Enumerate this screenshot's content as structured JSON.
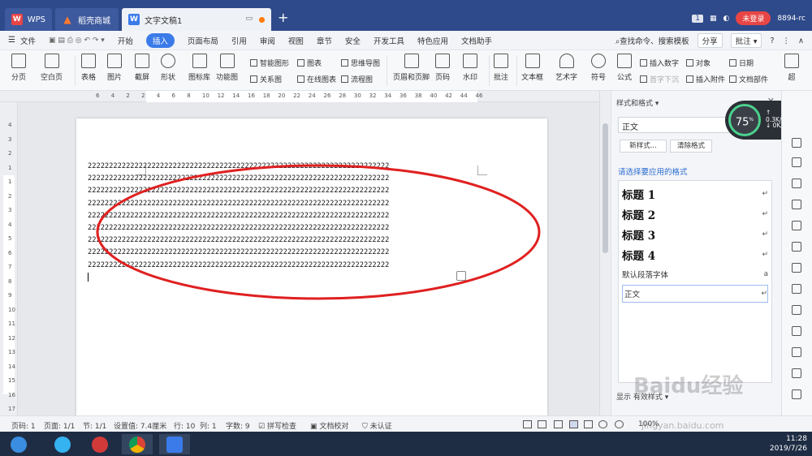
{
  "tabs": {
    "wps": "WPS",
    "mall": "稻壳商城",
    "doc": "文字文稿1",
    "badge_count": "1",
    "login": "未登录",
    "user": "8894-rc"
  },
  "menu": {
    "file": "文件",
    "items": [
      "开始",
      "插入",
      "页面布局",
      "引用",
      "审阅",
      "视图",
      "章节",
      "安全",
      "开发工具",
      "特色应用",
      "文档助手"
    ],
    "active_index": 1,
    "search": "查找命令、搜索模板",
    "share": "分享",
    "comment": "批注"
  },
  "ribbon": {
    "big": [
      "分页",
      "空白页",
      "表格",
      "图片",
      "截屏",
      "形状",
      "图标库",
      "功能图",
      "页眉和页脚",
      "页码",
      "水印",
      "批注",
      "文本框",
      "艺术字",
      "符号",
      "公式",
      "超"
    ],
    "small": {
      "smart_shape": "智能图形",
      "chart": "图表",
      "mind_map": "思维导图",
      "relation": "关系图",
      "online_chart": "在线图表",
      "flowchart": "流程图",
      "insert_number": "插入数字",
      "object": "对象",
      "date": "日期",
      "drop_cap": "首字下沉",
      "attachment": "插入附件",
      "doc_parts": "文档部件"
    }
  },
  "ruler": {
    "h_ticks": [
      "6",
      "4",
      "2",
      "2",
      "4",
      "6",
      "8",
      "10",
      "12",
      "14",
      "16",
      "18",
      "20",
      "22",
      "24",
      "26",
      "28",
      "30",
      "32",
      "34",
      "36",
      "38",
      "40",
      "42",
      "44",
      "46"
    ],
    "v_ticks": [
      "4",
      "3",
      "2",
      "1",
      "1",
      "2",
      "3",
      "4",
      "5",
      "6",
      "7",
      "8",
      "9",
      "10",
      "11",
      "12",
      "13",
      "14",
      "15",
      "16",
      "17"
    ]
  },
  "document": {
    "lines": [
      "22222222222222222222222222222222222222222222222222222222222222222222222",
      "22222222222222222222222222222222222222222222222222222222222222222222222",
      "22222222222222222222222222222222222222222222222222222222222222222222222",
      "22222222222222222222222222222222222222222222222222222222222222222222222",
      "22222222222222222222222222222222222222222222222222222222222222222222222",
      "22222222222222222222222222222222222222222222222222222222222222222222222",
      "22222222222222222222222222222222222222222222222222222222222222222222222",
      "22222222222222222222222222222222222222222222222222222222222222222222222",
      "22222222222222222222222222222222222222222222222222222222222222222222222"
    ]
  },
  "panel": {
    "title": "样式和格式",
    "current_style": "正文",
    "new_style": "新样式...",
    "clear_format": "清除格式",
    "apply_label": "请选择要应用的格式",
    "styles": [
      {
        "label": "标题 1",
        "mark": "↵"
      },
      {
        "label": "标题 2",
        "mark": "↵"
      },
      {
        "label": "标题 3",
        "mark": "↵"
      },
      {
        "label": "标题 4",
        "mark": "↵"
      },
      {
        "label": "默认段落字体",
        "mark": "a"
      },
      {
        "label": "正文",
        "mark": "↵"
      }
    ],
    "show_label": "显示",
    "show_value": "有效样式"
  },
  "speed": {
    "percent": "75",
    "unit": "%",
    "up": "0.3K/s",
    "down": "0K/s"
  },
  "status": {
    "page": "页码: 1",
    "pages": "页面: 1/1",
    "section": "节: 1/1",
    "setting": "设置值: 7.4厘米",
    "row": "行: 10",
    "col": "列: 1",
    "words": "字数: 9",
    "spell": "拼写检查",
    "proof": "文档校对",
    "auth": "未认证",
    "zoom": "100%"
  },
  "taskbar": {
    "time": "11:28",
    "date": "2019/7/26"
  },
  "watermark": {
    "logo": "Baidu经验",
    "url": "jingyan.baidu.com"
  },
  "colors": {
    "accent": "#3b7be9",
    "title_bar": "#2f4a8a",
    "annotation": "#e02020"
  }
}
